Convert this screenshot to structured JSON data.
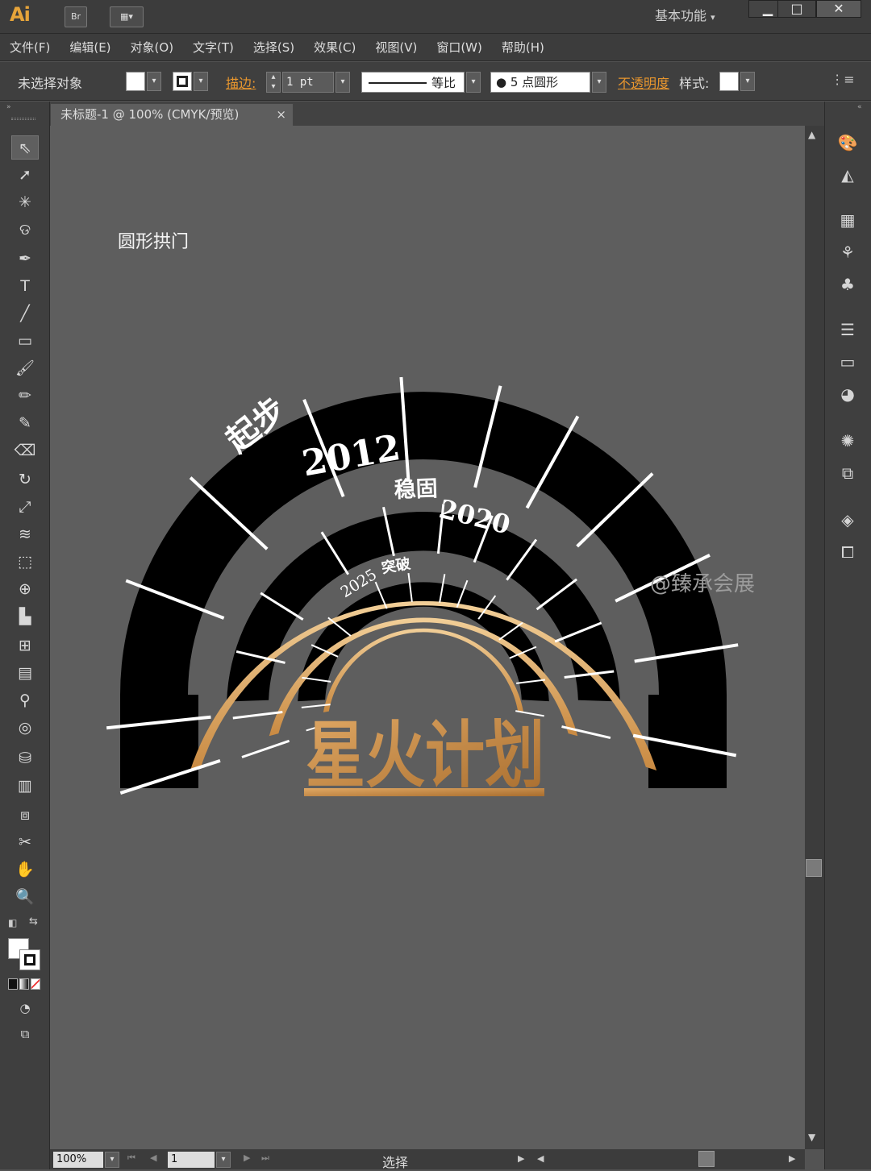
{
  "app": {
    "logo": "Ai",
    "bridge_label": "Br",
    "workspace": "基本功能"
  },
  "window_controls": {
    "minimize": "▁",
    "maximize": "□",
    "close": "✕"
  },
  "menus": [
    "文件(F)",
    "编辑(E)",
    "对象(O)",
    "文字(T)",
    "选择(S)",
    "效果(C)",
    "视图(V)",
    "窗口(W)",
    "帮助(H)"
  ],
  "control_bar": {
    "selection_status": "未选择对象",
    "stroke_label": "描边:",
    "stroke_weight": "1 pt",
    "profile_label": "等比",
    "brush_label": "5 点圆形",
    "opacity_label": "不透明度",
    "style_label": "样式:"
  },
  "document_tab": {
    "title": "未标题-1 @ 100% (CMYK/预览)",
    "close": "×"
  },
  "artwork": {
    "label": "圆形拱门",
    "outer_phase": "起步",
    "outer_year": "2012",
    "middle_phase": "稳固",
    "middle_year": "2020",
    "inner_year": "2025",
    "inner_phase": "突破",
    "title": "星火计划",
    "gold_light": "#f2cf98",
    "gold_dark": "#c98a42"
  },
  "watermark": "@臻承会展",
  "status": {
    "zoom": "100%",
    "artboard": "1",
    "tool": "选择"
  },
  "icons": [
    "selection-icon",
    "direct-selection-icon",
    "magic-wand-icon",
    "lasso-icon",
    "pen-icon",
    "type-icon",
    "line-icon",
    "rectangle-icon",
    "paintbrush-icon",
    "pencil-icon",
    "blob-brush-icon",
    "eraser-icon",
    "rotate-icon",
    "scale-icon",
    "warp-icon",
    "free-transform-icon",
    "shape-builder-icon",
    "perspective-grid-icon",
    "mesh-icon",
    "gradient-icon",
    "eyedropper-icon",
    "blend-icon",
    "symbol-sprayer-icon",
    "graph-icon",
    "artboard-icon",
    "slice-icon",
    "hand-icon",
    "zoom-icon"
  ]
}
